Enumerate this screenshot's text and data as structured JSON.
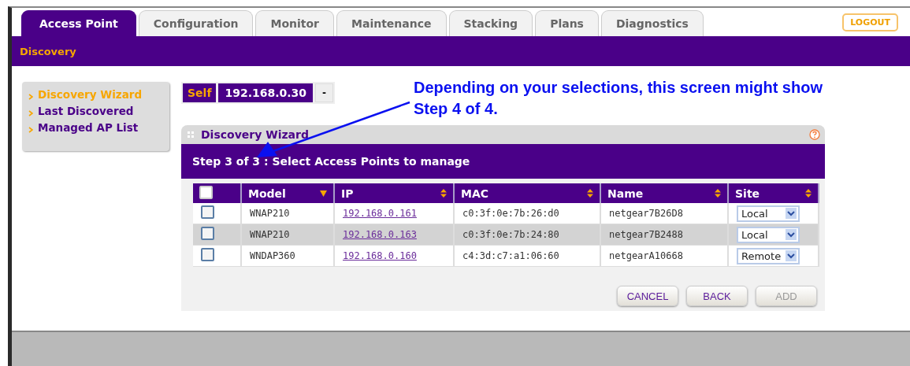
{
  "tabs": [
    {
      "label": "Access Point",
      "selected": true
    },
    {
      "label": "Configuration",
      "selected": false
    },
    {
      "label": "Monitor",
      "selected": false
    },
    {
      "label": "Maintenance",
      "selected": false
    },
    {
      "label": "Stacking",
      "selected": false
    },
    {
      "label": "Plans",
      "selected": false
    },
    {
      "label": "Diagnostics",
      "selected": false
    }
  ],
  "logout": "LOGOUT",
  "subnav": "Discovery",
  "sidebar": {
    "items": [
      {
        "label": "Discovery Wizard",
        "selected": true
      },
      {
        "label": "Last Discovered",
        "selected": false
      },
      {
        "label": "Managed AP List",
        "selected": false
      }
    ]
  },
  "device": {
    "label": "Self",
    "ip": "192.168.0.30",
    "toggle": "-"
  },
  "callout": "Depending on your selections, this screen might show Step 4 of 4.",
  "panel": {
    "title": "Discovery Wizard",
    "step": "Step 3 of 3 : Select Access Points to manage",
    "table": {
      "select_all_checked": false,
      "columns": [
        {
          "label": "Model",
          "sorted": true
        },
        {
          "label": "IP",
          "sorted": false
        },
        {
          "label": "MAC",
          "sorted": false
        },
        {
          "label": "Name",
          "sorted": false
        },
        {
          "label": "Site",
          "sorted": false
        }
      ],
      "rows": [
        {
          "checked": false,
          "model": "WNAP210",
          "ip": "192.168.0.161",
          "mac": "c0:3f:0e:7b:26:d0",
          "name": "netgear7B26D8",
          "site": "Local"
        },
        {
          "checked": false,
          "model": "WNAP210",
          "ip": "192.168.0.163",
          "mac": "c0:3f:0e:7b:24:80",
          "name": "netgear7B2488",
          "site": "Local"
        },
        {
          "checked": false,
          "model": "WNDAP360",
          "ip": "192.168.0.160",
          "mac": "c4:3d:c7:a1:06:60",
          "name": "netgearA10668",
          "site": "Remote"
        }
      ]
    },
    "buttons": [
      {
        "label": "CANCEL",
        "disabled": false
      },
      {
        "label": "BACK",
        "disabled": false
      },
      {
        "label": "ADD",
        "disabled": true
      }
    ]
  }
}
